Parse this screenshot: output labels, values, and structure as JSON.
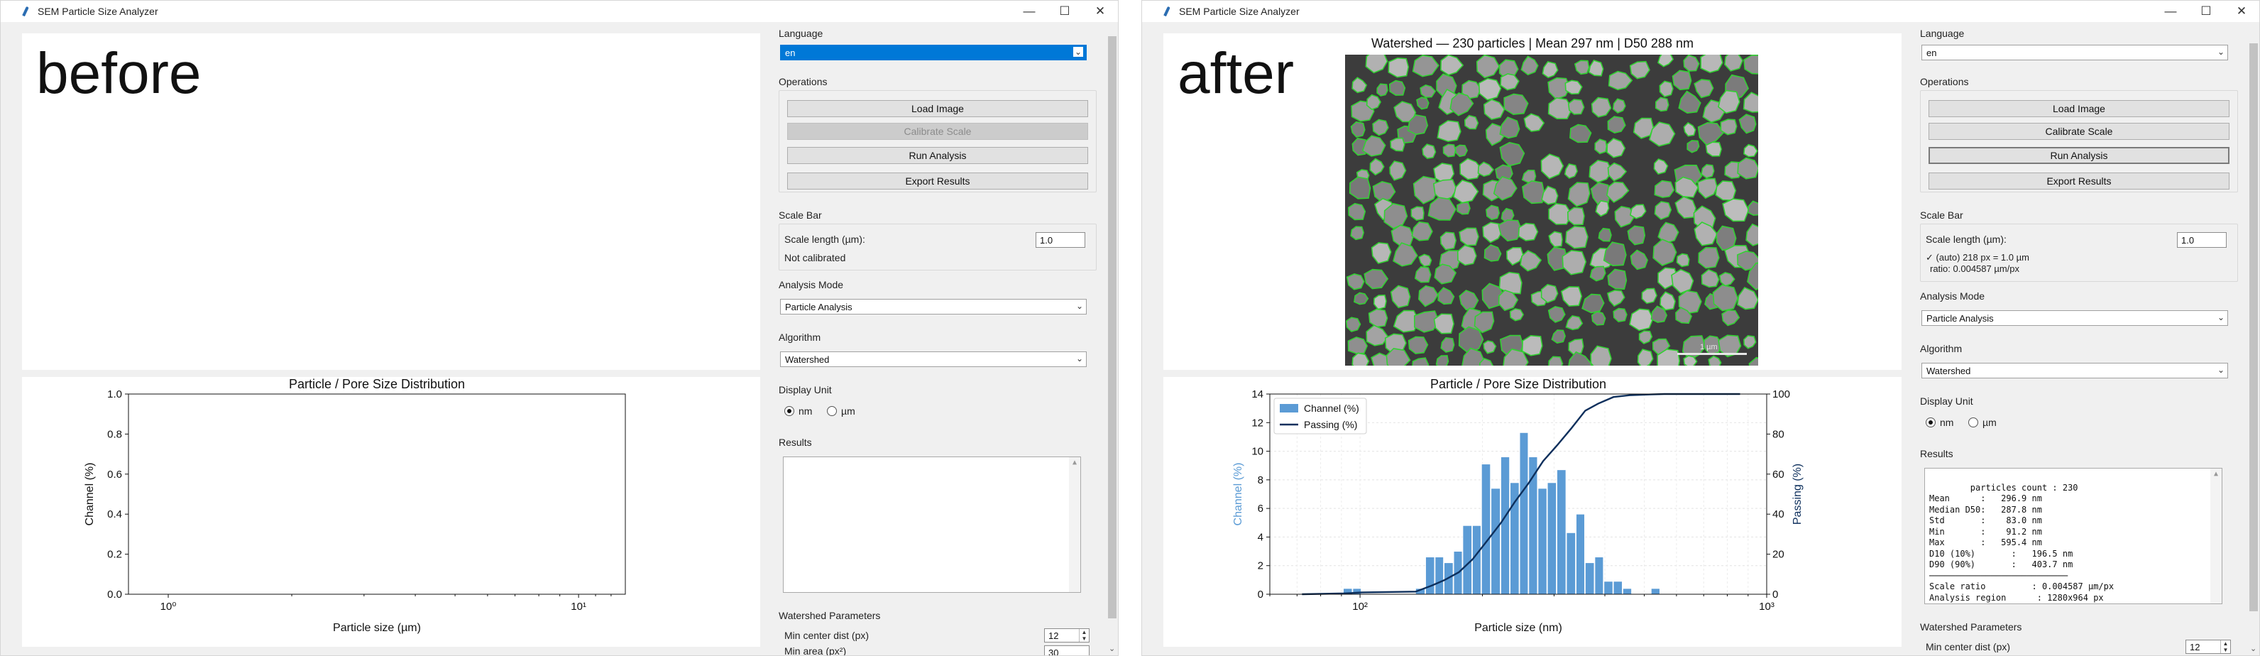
{
  "app_title": "SEM Particle Size Analyzer",
  "window_buttons": {
    "minimize": "—",
    "maximize": "☐",
    "close": "✕"
  },
  "before": {
    "overlay_word": "before",
    "plot_title": "Particle / Pore Size Distribution",
    "language_label": "Language",
    "language_value": "en",
    "operations_label": "Operations",
    "buttons": {
      "load": "Load Image",
      "calibrate": "Calibrate Scale",
      "run": "Run Analysis",
      "export": "Export Results"
    },
    "scale_bar_label": "Scale Bar",
    "scale_length_label": "Scale length (µm):",
    "scale_length_value": "1.0",
    "scale_status": "Not calibrated",
    "analysis_mode_label": "Analysis Mode",
    "analysis_mode_value": "Particle Analysis",
    "algorithm_label": "Algorithm",
    "algorithm_value": "Watershed",
    "display_unit_label": "Display Unit",
    "unit_nm": "nm",
    "unit_um": "µm",
    "results_label": "Results",
    "watershed_label": "Watershed Parameters",
    "min_center_dist_label": "Min center dist (px)",
    "min_center_dist_value": "12",
    "min_area_label": "Min area (px²)",
    "min_area_value": "30"
  },
  "after": {
    "overlay_word": "after",
    "image_title": "Watershed — 230 particles | Mean 297 nm | D50 288 nm",
    "scale_bar_text": "1 µm",
    "plot_title": "Particle / Pore Size Distribution",
    "language_label": "Language",
    "language_value": "en",
    "operations_label": "Operations",
    "buttons": {
      "load": "Load Image",
      "calibrate": "Calibrate Scale",
      "run": "Run Analysis",
      "export": "Export Results"
    },
    "scale_bar_label": "Scale Bar",
    "scale_length_label": "Scale length (µm):",
    "scale_length_value": "1.0",
    "scale_status_1": "✓ (auto) 218 px = 1.0 µm",
    "scale_status_2": "ratio: 0.004587 µm/px",
    "analysis_mode_label": "Analysis Mode",
    "analysis_mode_value": "Particle Analysis",
    "algorithm_label": "Algorithm",
    "algorithm_value": "Watershed",
    "display_unit_label": "Display Unit",
    "unit_nm": "nm",
    "unit_um": "µm",
    "results_label": "Results",
    "results_text": "particles count : 230\nMean      :   296.9 nm\nMedian D50:   287.8 nm\nStd       :    83.0 nm\nMin       :    91.2 nm\nMax       :   595.4 nm\nD10 (10%)       :   196.5 nm\nD90 (90%)       :   403.7 nm\n───────────────────────────\nScale ratio         : 0.004587 µm/px\nAnalysis region      : 1280x964 px",
    "watershed_label": "Watershed Parameters",
    "min_center_dist_label": "Min center dist (px)",
    "min_center_dist_value": "12"
  },
  "chart_data": [
    {
      "type": "line",
      "title": "Particle / Pore Size Distribution",
      "xlabel": "Particle size (µm)",
      "ylabel": "Channel (%)",
      "x_scale": "log",
      "xlim": [
        0.8,
        13
      ],
      "ylim": [
        0,
        1
      ],
      "x_ticks": [
        "10⁰",
        "10¹"
      ],
      "y_ticks": [
        "0.0",
        "0.2",
        "0.4",
        "0.6",
        "0.8",
        "1.0"
      ],
      "series": []
    },
    {
      "type": "bar",
      "title": "Particle / Pore Size Distribution",
      "xlabel": "Particle size (nm)",
      "ylabel": "Channel (%)",
      "y2label": "Passing (%)",
      "x_scale": "log",
      "xlim": [
        60,
        1000
      ],
      "ylim": [
        0,
        14
      ],
      "y2lim": [
        0,
        100
      ],
      "x_ticks": [
        "10²",
        "10³"
      ],
      "y_ticks": [
        "0",
        "2",
        "4",
        "6",
        "8",
        "10",
        "12",
        "14"
      ],
      "y2_ticks": [
        "0",
        "20",
        "40",
        "60",
        "80",
        "100"
      ],
      "legend_position": "top-left",
      "grid": true,
      "series": [
        {
          "name": "Channel (%)",
          "color": "#5b9bd5",
          "bins": [
            [
              91,
              96
            ],
            [
              96,
              101
            ],
            [
              137,
              145
            ],
            [
              145,
              153
            ],
            [
              153,
              161
            ],
            [
              161,
              170
            ],
            [
              170,
              179
            ],
            [
              179,
              189
            ],
            [
              189,
              199
            ],
            [
              199,
              210
            ],
            [
              210,
              222
            ],
            [
              222,
              234
            ],
            [
              234,
              247
            ],
            [
              247,
              260
            ],
            [
              260,
              274
            ],
            [
              274,
              289
            ],
            [
              289,
              305
            ],
            [
              305,
              322
            ],
            [
              322,
              340
            ],
            [
              340,
              358
            ],
            [
              358,
              378
            ],
            [
              378,
              398
            ],
            [
              398,
              420
            ],
            [
              420,
              443
            ],
            [
              443,
              467
            ],
            [
              467,
              493
            ],
            [
              520,
              548
            ]
          ],
          "values": [
            0.4,
            0.4,
            0.4,
            2.6,
            2.6,
            2.2,
            3.0,
            4.8,
            4.8,
            9.1,
            7.4,
            9.6,
            7.8,
            11.3,
            9.6,
            7.4,
            7.8,
            8.7,
            4.3,
            5.6,
            2.2,
            2.6,
            0.9,
            0.9,
            0.4,
            0.0,
            0.4
          ],
          "values_start_index": 0
        },
        {
          "name": "Passing (%)",
          "color": "#0d2f5c",
          "axis": "y2",
          "x": [
            72,
            91,
            101,
            137,
            150,
            161,
            175,
            189,
            205,
            222,
            240,
            260,
            282,
            305,
            330,
            358,
            385,
            420,
            460,
            520,
            560,
            860
          ],
          "y": [
            0,
            0.4,
            0.9,
            1.3,
            4.3,
            7.0,
            11.0,
            17.4,
            26.5,
            35.6,
            46.0,
            55.6,
            66.5,
            74.3,
            82.6,
            91.7,
            95.2,
            98.5,
            99.4,
            99.8,
            100,
            100
          ]
        }
      ]
    }
  ]
}
